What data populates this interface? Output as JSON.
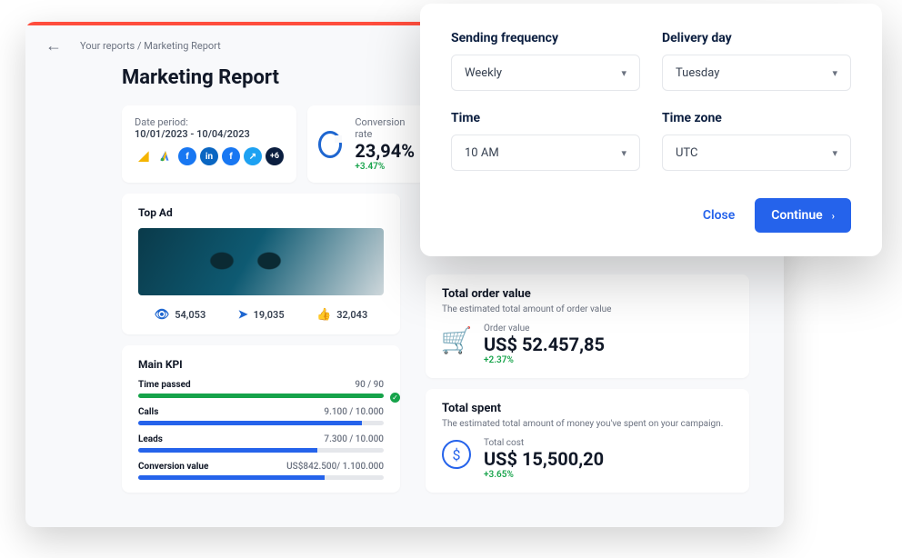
{
  "breadcrumb": "Your reports / Marketing Report",
  "title": "Marketing Report",
  "period": {
    "label": "Date period:",
    "value": "10/01/2023 - 10/04/2023",
    "more": "+6"
  },
  "conversion": {
    "label": "Conversion rate",
    "value": "23,94%",
    "delta": "+3.47%"
  },
  "topad": {
    "label": "Top Ad",
    "views": "54,053",
    "sends": "19,035",
    "likes": "32,043"
  },
  "kpi": {
    "label": "Main KPI",
    "rows": [
      {
        "name": "Time passed",
        "val": "90 / 90",
        "pct": 100,
        "green": true,
        "check": true
      },
      {
        "name": "Calls",
        "val": "9.100 / 10.000",
        "pct": 91
      },
      {
        "name": "Leads",
        "val": "7.300 / 10.000",
        "pct": 73
      },
      {
        "name": "Conversion value",
        "val": "US$842.500/ 1.100.000",
        "pct": 76
      }
    ]
  },
  "order": {
    "title": "Total order value",
    "sub": "The estimated total amount of order value",
    "lbl": "Order value",
    "val": "US$ 52.457,85",
    "delta": "+2.37%"
  },
  "spent": {
    "title": "Total spent",
    "sub": "The estimated total amount of money you've spent on your campaign.",
    "lbl": "Total cost",
    "val": "US$ 15,500,20",
    "delta": "+3.65%"
  },
  "modal": {
    "freq": {
      "label": "Sending frequency",
      "value": "Weekly"
    },
    "day": {
      "label": "Delivery day",
      "value": "Tuesday"
    },
    "time": {
      "label": "Time",
      "value": "10 AM"
    },
    "tz": {
      "label": "Time zone",
      "value": "UTC"
    },
    "close": "Close",
    "continue": "Continue"
  }
}
